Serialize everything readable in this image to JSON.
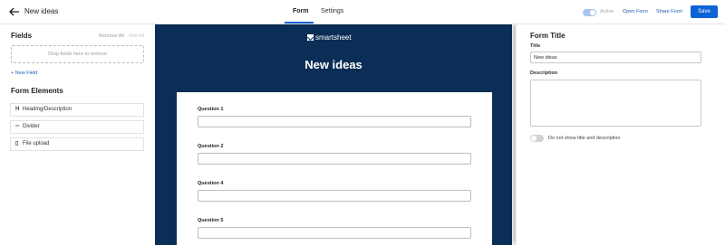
{
  "header": {
    "page_name": "New ideas",
    "tabs": [
      {
        "label": "Form"
      },
      {
        "label": "Settings"
      }
    ],
    "active_label": "Active",
    "open_form": "Open Form",
    "share_form": "Share Form",
    "save": "Save",
    "active_toggle_on": true
  },
  "fields_panel": {
    "title": "Fields",
    "remove_all": "Remove All",
    "add_all": "Add All",
    "dropzone": "Drop fields here to remove",
    "new_field": "+ New Field"
  },
  "elements_panel": {
    "title": "Form Elements",
    "items": [
      {
        "label": "Heading/Description",
        "icon": "heading-icon"
      },
      {
        "label": "Divider",
        "icon": "divider-icon"
      },
      {
        "label": "File upload",
        "icon": "file-icon"
      }
    ]
  },
  "canvas": {
    "logo_text": "smartsheet",
    "heading": "New ideas",
    "questions": [
      {
        "label": "Question 1"
      },
      {
        "label": "Question 2"
      },
      {
        "label": "Question 4"
      },
      {
        "label": "Question 5"
      }
    ]
  },
  "title_panel": {
    "title": "Form Title",
    "title_label": "Title",
    "title_value": "New ideas",
    "description_label": "Description",
    "hide_label": "Do not show title and description",
    "hide_toggle_on": false
  },
  "colors": {
    "accent": "#0b63d6",
    "canvas_bg": "#0a2e55"
  }
}
